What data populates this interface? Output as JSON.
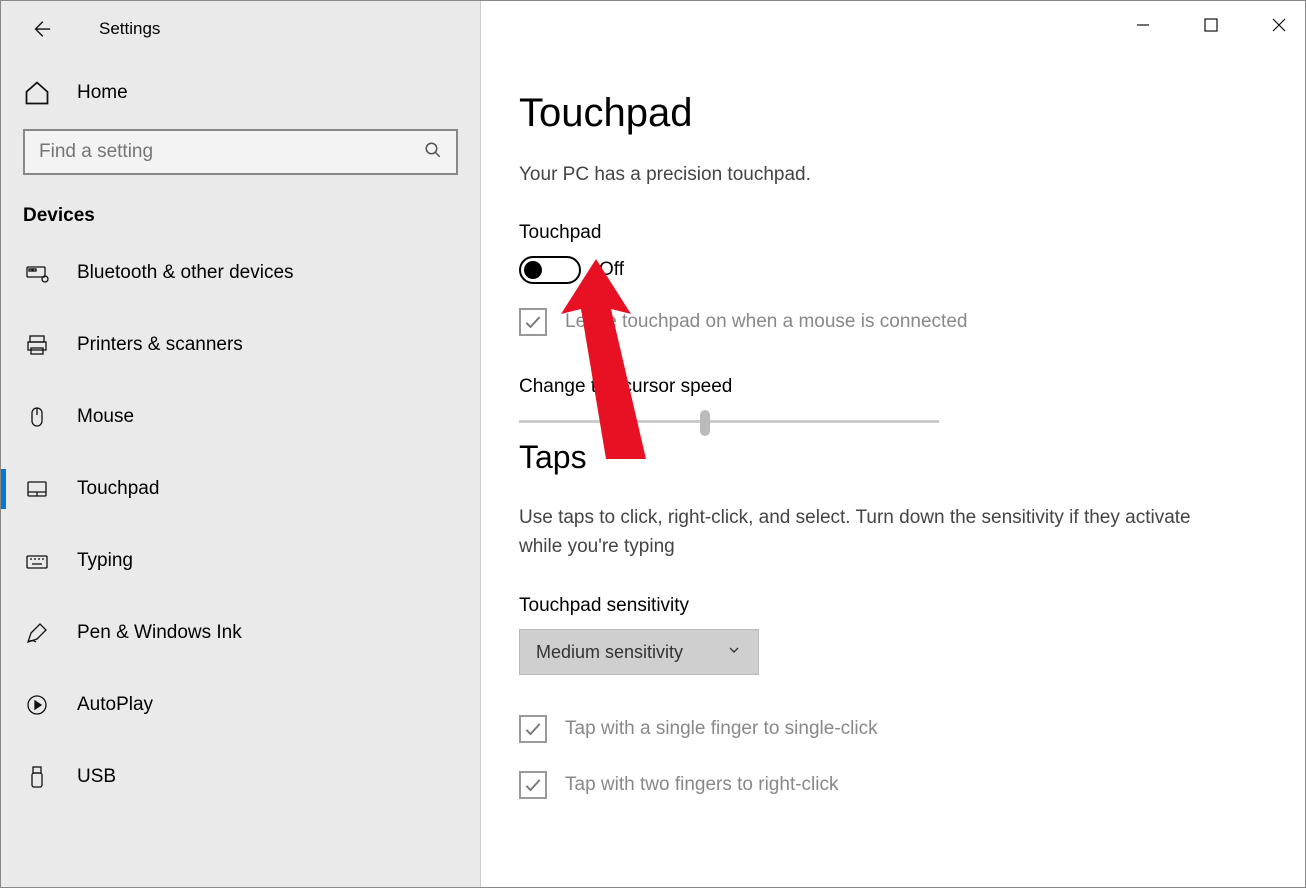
{
  "header": {
    "title": "Settings"
  },
  "home": {
    "label": "Home"
  },
  "search": {
    "placeholder": "Find a setting"
  },
  "category": "Devices",
  "sidebar": {
    "items": [
      {
        "label": "Bluetooth & other devices"
      },
      {
        "label": "Printers & scanners"
      },
      {
        "label": "Mouse"
      },
      {
        "label": "Touchpad"
      },
      {
        "label": "Typing"
      },
      {
        "label": "Pen & Windows Ink"
      },
      {
        "label": "AutoPlay"
      },
      {
        "label": "USB"
      }
    ]
  },
  "main": {
    "title": "Touchpad",
    "precision_text": "Your PC has a precision touchpad.",
    "touchpad_label": "Touchpad",
    "toggle_state": "Off",
    "leave_on_label": "Leave touchpad on when a mouse is connected",
    "cursor_speed_label": "Change the cursor speed",
    "taps_title": "Taps",
    "taps_desc": "Use taps to click, right-click, and select. Turn down the sensitivity if they activate while you're typing",
    "sensitivity_label": "Touchpad sensitivity",
    "sensitivity_value": "Medium sensitivity",
    "tap_single": "Tap with a single finger to single-click",
    "tap_two": "Tap with two fingers to right-click"
  }
}
